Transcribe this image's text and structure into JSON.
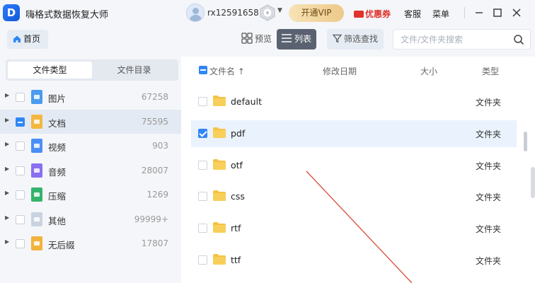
{
  "app": {
    "title": "嗨格式数据恢复大师",
    "logo_letter": "D"
  },
  "user": {
    "name": "rx12591658"
  },
  "titlebar": {
    "vip_button": "开通VIP",
    "coupon": "优惠券",
    "service": "客服",
    "menu": "菜单"
  },
  "toolbar": {
    "home": "首页",
    "view_preview": "预览",
    "view_list": "列表",
    "filter": "筛选查找",
    "search_placeholder": "文件/文件夹搜索"
  },
  "sidebar": {
    "tabs": [
      "文件类型",
      "文件目录"
    ],
    "active_tab": 0,
    "categories": [
      {
        "label": "图片",
        "count": "67258",
        "icon": "image-file-icon",
        "color": "#4a9bf2",
        "checked": false,
        "selected": false
      },
      {
        "label": "文档",
        "count": "75595",
        "icon": "document-file-icon",
        "color": "#f3b740",
        "checked": "partial",
        "selected": true
      },
      {
        "label": "视频",
        "count": "903",
        "icon": "video-file-icon",
        "color": "#4a8ff5",
        "checked": false,
        "selected": false
      },
      {
        "label": "音频",
        "count": "28007",
        "icon": "audio-file-icon",
        "color": "#8a6ff0",
        "checked": false,
        "selected": false
      },
      {
        "label": "压缩",
        "count": "1269",
        "icon": "archive-file-icon",
        "color": "#34b36b",
        "checked": false,
        "selected": false
      },
      {
        "label": "其他",
        "count": "99999+",
        "icon": "other-file-icon",
        "color": "#c9d3e0",
        "checked": false,
        "selected": false
      },
      {
        "label": "无后缀",
        "count": "17807",
        "icon": "no-extension-file-icon",
        "color": "#f2b33c",
        "checked": false,
        "selected": false
      }
    ]
  },
  "list": {
    "columns": {
      "name": "文件名",
      "sort_arrow": "↑",
      "date": "修改日期",
      "size": "大小",
      "type": "类型"
    },
    "rows": [
      {
        "name": "default",
        "type": "文件夹",
        "checked": false,
        "selected": false
      },
      {
        "name": "pdf",
        "type": "文件夹",
        "checked": true,
        "selected": true
      },
      {
        "name": "otf",
        "type": "文件夹",
        "checked": false,
        "selected": false
      },
      {
        "name": "css",
        "type": "文件夹",
        "checked": false,
        "selected": false
      },
      {
        "name": "rtf",
        "type": "文件夹",
        "checked": false,
        "selected": false
      },
      {
        "name": "ttf",
        "type": "文件夹",
        "checked": false,
        "selected": false
      }
    ]
  },
  "colors": {
    "accent": "#2f86f6",
    "folder": "#f5c244",
    "annotation_line": "#d94a3a"
  }
}
